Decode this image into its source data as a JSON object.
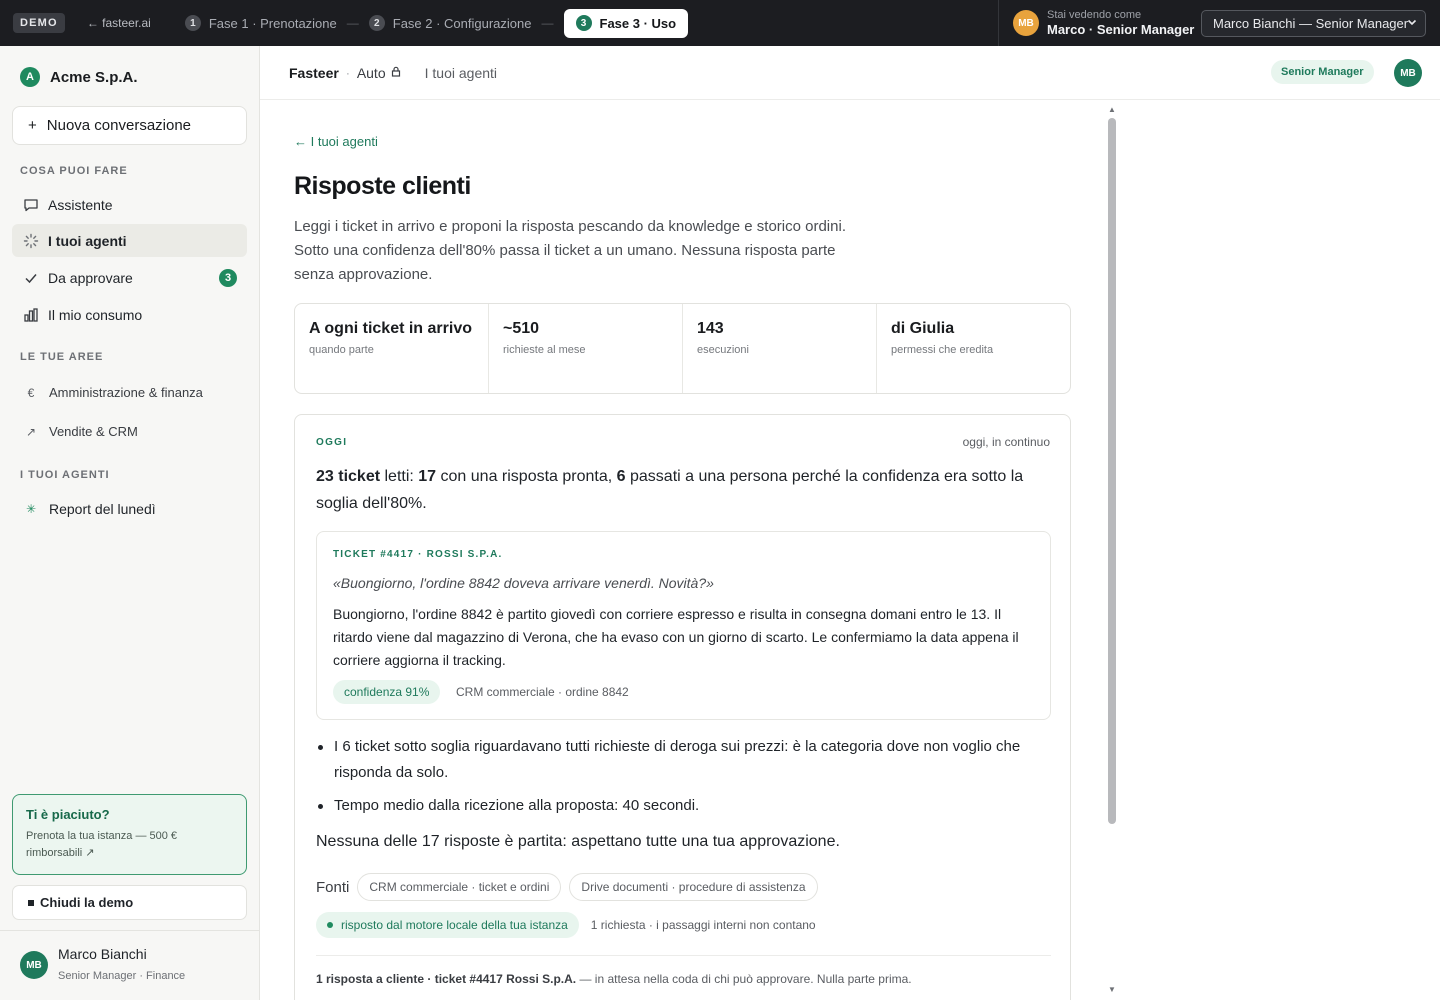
{
  "topbar": {
    "demo": "DEMO",
    "back": "← fasteer.ai",
    "phases": [
      {
        "num": "1",
        "label": "Fase 1 · Prenotazione"
      },
      {
        "num": "2",
        "label": "Fase 2 · Configurazione"
      },
      {
        "num": "3",
        "label": "Fase 3 · Uso"
      }
    ],
    "phase_sep": "—",
    "viewer_avatar": "MB",
    "viewer_label": "Stai vedendo come",
    "viewer_name": "Marco · Senior Manager",
    "role_select": "Marco Bianchi — Senior Manager"
  },
  "sidebar": {
    "org_initial": "A",
    "org_name": "Acme S.p.A.",
    "new_conversation": "Nuova conversazione",
    "sections": {
      "what": "COSA PUOI FARE",
      "areas": "LE TUE AREE",
      "agents": "I TUOI AGENTI"
    },
    "nav": [
      {
        "label": "Assistente",
        "icon": "chat-icon"
      },
      {
        "label": "I tuoi agenti",
        "icon": "spinner-icon"
      },
      {
        "label": "Da approvare",
        "icon": "check-icon",
        "badge": "3"
      },
      {
        "label": "Il mio consumo",
        "icon": "bar-chart-icon"
      }
    ],
    "areas": [
      {
        "label": "Amministrazione & finanza",
        "icon": "euro-icon"
      },
      {
        "label": "Vendite & CRM",
        "icon": "trend-arrow-icon"
      }
    ],
    "agents": [
      {
        "label": "Report del lunedì",
        "icon": "asterisk-icon"
      }
    ],
    "liked_title": "Ti è piaciuto?",
    "liked_text": "Prenota la tua istanza — 500 € rimborsabili ↗",
    "close_demo": "Chiudi la demo",
    "user_initials": "MB",
    "user_name": "Marco Bianchi",
    "user_role": "Senior Manager · Finance"
  },
  "header": {
    "brand": "Fasteer",
    "sep": "·",
    "mode": "Auto",
    "link": "I tuoi agenti",
    "role_pill": "Senior Manager",
    "avatar": "MB"
  },
  "main": {
    "back": "← I tuoi agenti",
    "title": "Risposte clienti",
    "description": "Leggi i ticket in arrivo e proponi la risposta pescando da knowledge e storico ordini. Sotto una confidenza dell'80% passa il ticket a un umano. Nessuna risposta parte senza approvazione.",
    "stats": [
      {
        "value": "A ogni ticket in arrivo",
        "label": "quando parte"
      },
      {
        "value": "~510",
        "label": "richieste al mese"
      },
      {
        "value": "143",
        "label": "esecuzioni"
      },
      {
        "value": "di Giulia",
        "label": "permessi che eredita"
      }
    ],
    "today": {
      "label": "OGGI",
      "when": "oggi, in continuo",
      "summary": {
        "count": "23 ticket",
        "t1": " letti: ",
        "ready": "17",
        "t2": " con una risposta pronta, ",
        "passed": "6",
        "t3": " passati a una persona perché la confidenza era sotto la soglia dell'80%."
      },
      "ticket": {
        "label": "TICKET #4417 · ROSSI S.P.A.",
        "quote": "«Buongiorno, l'ordine 8842 doveva arrivare venerdì. Novità?»",
        "reply": "Buongiorno, l'ordine 8842 è partito giovedì con corriere espresso e risulta in consegna domani entro le 13. Il ritardo viene dal magazzino di Verona, che ha evaso con un giorno di scarto. Le confermiamo la data appena il corriere aggiorna il tracking.",
        "confidence": "confidenza 91%",
        "source": "CRM commerciale · ordine 8842"
      },
      "bullets": [
        "I 6 ticket sotto soglia riguardavano tutti richieste di deroga sui prezzi: è la categoria dove non voglio che risponda da solo.",
        "Tempo medio dalla ricezione alla proposta: 40 secondi."
      ],
      "closing": "Nessuna delle 17 risposte è partita: aspettano tutte una tua approvazione.",
      "sources_label": "Fonti",
      "sources": [
        "CRM commerciale · ticket e ordini",
        "Drive documenti · procedure di assistenza"
      ],
      "engine": "risposto dal motore locale della tua istanza",
      "engine_note": "1 richiesta · i passaggi interni non contano",
      "footer_bold": "1 risposta a cliente · ticket #4417 Rossi S.p.A.",
      "footer_rest": " — in attesa nella coda di chi può approvare. Nulla parte prima."
    }
  }
}
